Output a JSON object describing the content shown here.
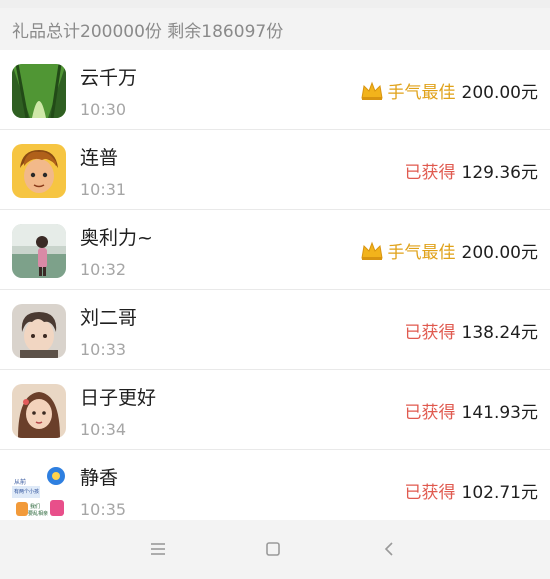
{
  "summary_text": "礼品总计200000份 剩余186097份",
  "items": [
    {
      "name": "云千万",
      "time": "10:30",
      "badge": "手气最佳",
      "badge_type": "best",
      "amount": "200.00元",
      "avatar": "bamboo-forest"
    },
    {
      "name": "连普",
      "time": "10:31",
      "badge": "已获得",
      "badge_type": "got",
      "amount": "129.36元",
      "avatar": "cartoon-boy"
    },
    {
      "name": "奥利力~",
      "time": "10:32",
      "badge": "手气最佳",
      "badge_type": "best",
      "amount": "200.00元",
      "avatar": "girl-photo"
    },
    {
      "name": "刘二哥",
      "time": "10:33",
      "badge": "已获得",
      "badge_type": "got",
      "amount": "138.24元",
      "avatar": "anime-boy"
    },
    {
      "name": "日子更好",
      "time": "10:34",
      "badge": "已获得",
      "badge_type": "got",
      "amount": "141.93元",
      "avatar": "painted-girl"
    },
    {
      "name": "静香",
      "time": "10:35",
      "badge": "已获得",
      "badge_type": "got",
      "amount": "102.71元",
      "avatar": "cartoon-group"
    }
  ],
  "avatar_badge_texts": [
    "从前",
    "有两个小孩",
    "我们",
    "要乱相亲"
  ],
  "colors": {
    "best": "#e0a21a",
    "got": "#e05a4f"
  },
  "nav_icons": [
    "menu-icon",
    "home-square-icon",
    "back-chevron-icon"
  ]
}
